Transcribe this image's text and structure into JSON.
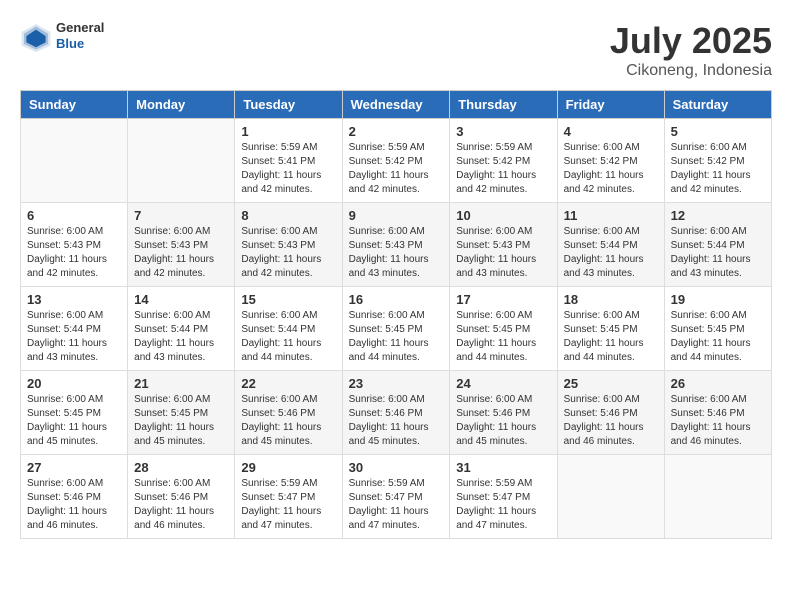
{
  "logo": {
    "general": "General",
    "blue": "Blue"
  },
  "header": {
    "title": "July 2025",
    "subtitle": "Cikoneng, Indonesia"
  },
  "weekdays": [
    "Sunday",
    "Monday",
    "Tuesday",
    "Wednesday",
    "Thursday",
    "Friday",
    "Saturday"
  ],
  "weeks": [
    [
      {
        "day": "",
        "info": ""
      },
      {
        "day": "",
        "info": ""
      },
      {
        "day": "1",
        "info": "Sunrise: 5:59 AM\nSunset: 5:41 PM\nDaylight: 11 hours and 42 minutes."
      },
      {
        "day": "2",
        "info": "Sunrise: 5:59 AM\nSunset: 5:42 PM\nDaylight: 11 hours and 42 minutes."
      },
      {
        "day": "3",
        "info": "Sunrise: 5:59 AM\nSunset: 5:42 PM\nDaylight: 11 hours and 42 minutes."
      },
      {
        "day": "4",
        "info": "Sunrise: 6:00 AM\nSunset: 5:42 PM\nDaylight: 11 hours and 42 minutes."
      },
      {
        "day": "5",
        "info": "Sunrise: 6:00 AM\nSunset: 5:42 PM\nDaylight: 11 hours and 42 minutes."
      }
    ],
    [
      {
        "day": "6",
        "info": "Sunrise: 6:00 AM\nSunset: 5:43 PM\nDaylight: 11 hours and 42 minutes."
      },
      {
        "day": "7",
        "info": "Sunrise: 6:00 AM\nSunset: 5:43 PM\nDaylight: 11 hours and 42 minutes."
      },
      {
        "day": "8",
        "info": "Sunrise: 6:00 AM\nSunset: 5:43 PM\nDaylight: 11 hours and 42 minutes."
      },
      {
        "day": "9",
        "info": "Sunrise: 6:00 AM\nSunset: 5:43 PM\nDaylight: 11 hours and 43 minutes."
      },
      {
        "day": "10",
        "info": "Sunrise: 6:00 AM\nSunset: 5:43 PM\nDaylight: 11 hours and 43 minutes."
      },
      {
        "day": "11",
        "info": "Sunrise: 6:00 AM\nSunset: 5:44 PM\nDaylight: 11 hours and 43 minutes."
      },
      {
        "day": "12",
        "info": "Sunrise: 6:00 AM\nSunset: 5:44 PM\nDaylight: 11 hours and 43 minutes."
      }
    ],
    [
      {
        "day": "13",
        "info": "Sunrise: 6:00 AM\nSunset: 5:44 PM\nDaylight: 11 hours and 43 minutes."
      },
      {
        "day": "14",
        "info": "Sunrise: 6:00 AM\nSunset: 5:44 PM\nDaylight: 11 hours and 43 minutes."
      },
      {
        "day": "15",
        "info": "Sunrise: 6:00 AM\nSunset: 5:44 PM\nDaylight: 11 hours and 44 minutes."
      },
      {
        "day": "16",
        "info": "Sunrise: 6:00 AM\nSunset: 5:45 PM\nDaylight: 11 hours and 44 minutes."
      },
      {
        "day": "17",
        "info": "Sunrise: 6:00 AM\nSunset: 5:45 PM\nDaylight: 11 hours and 44 minutes."
      },
      {
        "day": "18",
        "info": "Sunrise: 6:00 AM\nSunset: 5:45 PM\nDaylight: 11 hours and 44 minutes."
      },
      {
        "day": "19",
        "info": "Sunrise: 6:00 AM\nSunset: 5:45 PM\nDaylight: 11 hours and 44 minutes."
      }
    ],
    [
      {
        "day": "20",
        "info": "Sunrise: 6:00 AM\nSunset: 5:45 PM\nDaylight: 11 hours and 45 minutes."
      },
      {
        "day": "21",
        "info": "Sunrise: 6:00 AM\nSunset: 5:45 PM\nDaylight: 11 hours and 45 minutes."
      },
      {
        "day": "22",
        "info": "Sunrise: 6:00 AM\nSunset: 5:46 PM\nDaylight: 11 hours and 45 minutes."
      },
      {
        "day": "23",
        "info": "Sunrise: 6:00 AM\nSunset: 5:46 PM\nDaylight: 11 hours and 45 minutes."
      },
      {
        "day": "24",
        "info": "Sunrise: 6:00 AM\nSunset: 5:46 PM\nDaylight: 11 hours and 45 minutes."
      },
      {
        "day": "25",
        "info": "Sunrise: 6:00 AM\nSunset: 5:46 PM\nDaylight: 11 hours and 46 minutes."
      },
      {
        "day": "26",
        "info": "Sunrise: 6:00 AM\nSunset: 5:46 PM\nDaylight: 11 hours and 46 minutes."
      }
    ],
    [
      {
        "day": "27",
        "info": "Sunrise: 6:00 AM\nSunset: 5:46 PM\nDaylight: 11 hours and 46 minutes."
      },
      {
        "day": "28",
        "info": "Sunrise: 6:00 AM\nSunset: 5:46 PM\nDaylight: 11 hours and 46 minutes."
      },
      {
        "day": "29",
        "info": "Sunrise: 5:59 AM\nSunset: 5:47 PM\nDaylight: 11 hours and 47 minutes."
      },
      {
        "day": "30",
        "info": "Sunrise: 5:59 AM\nSunset: 5:47 PM\nDaylight: 11 hours and 47 minutes."
      },
      {
        "day": "31",
        "info": "Sunrise: 5:59 AM\nSunset: 5:47 PM\nDaylight: 11 hours and 47 minutes."
      },
      {
        "day": "",
        "info": ""
      },
      {
        "day": "",
        "info": ""
      }
    ]
  ]
}
